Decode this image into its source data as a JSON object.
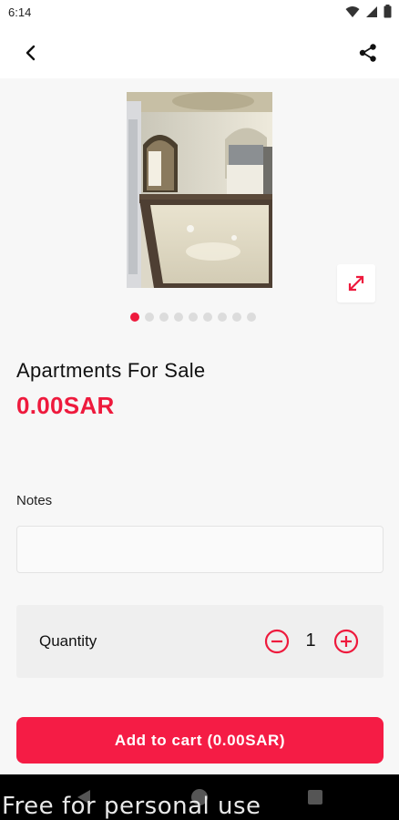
{
  "status_bar": {
    "time": "6:14"
  },
  "product": {
    "title": "Apartments For Sale",
    "price": "0.00SAR",
    "image_icon": "apartment-photo",
    "image_count": 9,
    "active_image_index": 0
  },
  "notes": {
    "label": "Notes",
    "value": "",
    "placeholder": ""
  },
  "quantity": {
    "label": "Quantity",
    "value": "1"
  },
  "cart_button": {
    "label": "Add to cart (0.00SAR)"
  },
  "watermark": "Free for personal use",
  "colors": {
    "accent": "#ee1a3d",
    "button": "#f51c45"
  },
  "icons": {
    "back": "back-arrow-icon",
    "share": "share-icon",
    "expand": "expand-icon",
    "minus": "minus-circle-icon",
    "plus": "plus-circle-icon"
  }
}
